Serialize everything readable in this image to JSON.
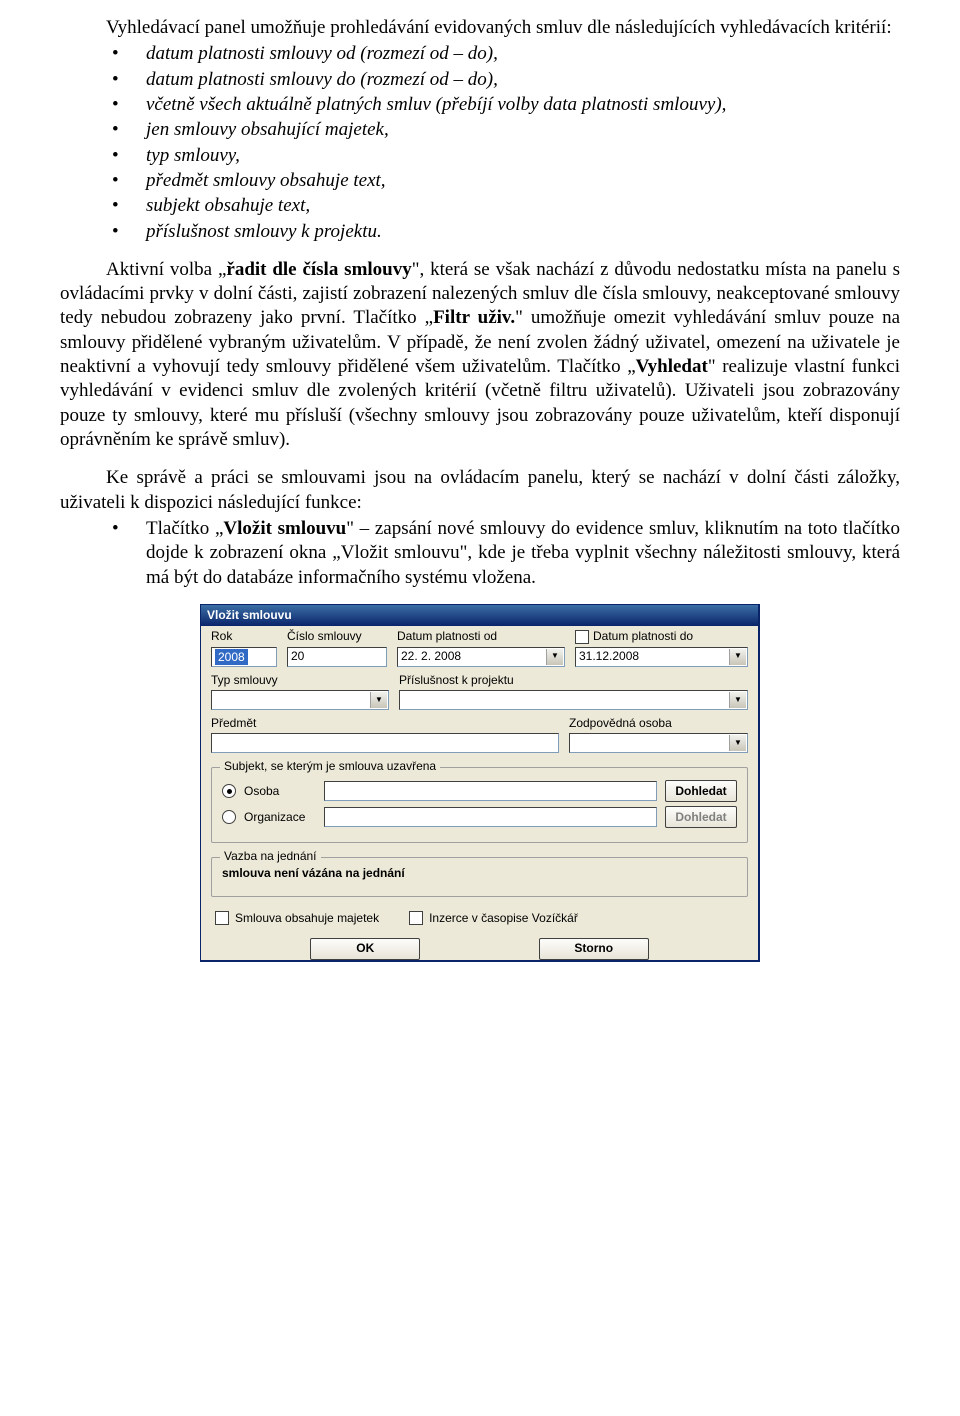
{
  "para1_lead": "Vyhledávací panel umožňuje prohledávání evidovaných smluv dle následujících vyhledávacích kritérií:",
  "criteria": [
    "datum platnosti smlouvy od (rozmezí od – do),",
    "datum platnosti smlouvy do (rozmezí od – do),",
    "včetně všech aktuálně platných smluv (přebíjí volby data platnosti smlouvy),",
    "jen smlouvy obsahující majetek,",
    "typ smlouvy,",
    "předmět smlouvy obsahuje text,",
    "subjekt obsahuje text,",
    "příslušnost smlouvy k projektu."
  ],
  "para2_a": "Aktivní volba „",
  "para2_bold1": "řadit dle čísla smlouvy",
  "para2_b": "\", která se však nachází z důvodu nedostatku místa na panelu s ovládacími prvky v dolní části, zajistí zobrazení nalezených smluv dle čísla smlouvy, neakceptované smlouvy tedy nebudou zobrazeny jako první. Tlačítko „",
  "para2_bold2": "Filtr uživ.",
  "para2_c": "\" umožňuje omezit vyhledávání smluv pouze na smlouvy přidělené vybraným uživatelům. V případě, že není zvolen žádný uživatel, omezení na uživatele je neaktivní a vyhovují tedy smlouvy přidělené všem uživatelům. Tlačítko „",
  "para2_bold3": "Vyhledat",
  "para2_d": "\" realizuje vlastní funkci vyhledávání v evidenci smluv dle zvolených kritérií (včetně filtru uživatelů). Uživateli jsou zobrazovány pouze ty smlouvy, které  mu přísluší (všechny smlouvy jsou zobrazovány pouze uživatelům, kteří disponují oprávněním ke správě smluv).",
  "para3": "Ke správě a práci se smlouvami jsou na ovládacím panelu, který se nachází v dolní části záložky, uživateli k dispozici následující funkce:",
  "func1_a": "Tlačítko „",
  "func1_bold": "Vložit smlouvu",
  "func1_b": "\" – zapsání nové smlouvy do evidence smluv, kliknutím na toto tlačítko dojde k zobrazení okna „Vložit smlouvu\", kde je třeba vyplnit všechny náležitosti smlouvy, která má být do databáze informačního systému vložena.",
  "dlg": {
    "title": "Vložit smlouvu",
    "rok_label": "Rok",
    "rok_value": "2008",
    "cislo_label": "Číslo smlouvy",
    "cislo_value": "20",
    "platod_label": "Datum platnosti od",
    "platod_value": "22. 2. 2008",
    "platdo_label": "Datum platnosti do",
    "platdo_value": "31.12.2008",
    "typ_label": "Typ smlouvy",
    "prislus_label": "Příslušnost k projektu",
    "predmet_label": "Předmět",
    "zodpov_label": "Zodpovědná osoba",
    "subjekt_legend": "Subjekt, se kterým je smlouva uzavřena",
    "osoba_label": "Osoba",
    "org_label": "Organizace",
    "dohledat": "Dohledat",
    "vazba_legend": "Vazba na jednání",
    "vazba_text": "smlouva není vázána na jednání",
    "chk_majetek": "Smlouva obsahuje majetek",
    "chk_inzerce": "Inzerce v časopise Vozíčkář",
    "ok": "OK",
    "storno": "Storno"
  }
}
